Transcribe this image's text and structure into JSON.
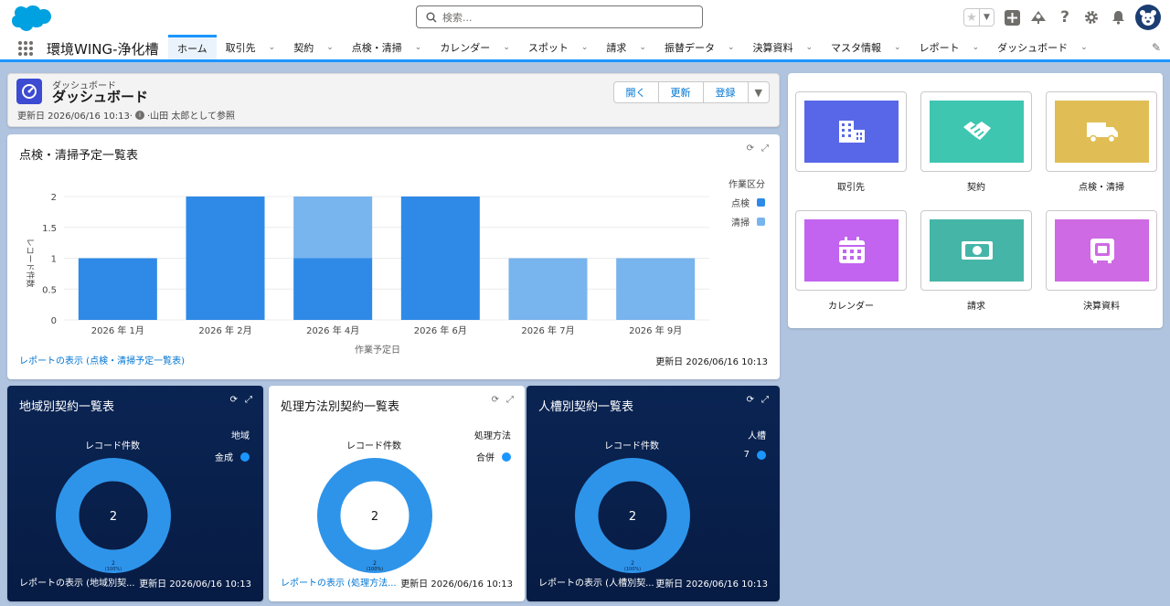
{
  "header": {
    "search_placeholder": "検索..."
  },
  "nav": {
    "app_name": "環境WING-浄化槽",
    "tabs": [
      {
        "label": "ホーム",
        "active": true,
        "has_menu": false
      },
      {
        "label": "取引先",
        "has_menu": true
      },
      {
        "label": "契約",
        "has_menu": true
      },
      {
        "label": "点検・清掃",
        "has_menu": true
      },
      {
        "label": "カレンダー",
        "has_menu": true
      },
      {
        "label": "スポット",
        "has_menu": true
      },
      {
        "label": "請求",
        "has_menu": true
      },
      {
        "label": "振替データ",
        "has_menu": true
      },
      {
        "label": "決算資料",
        "has_menu": true
      },
      {
        "label": "マスタ情報",
        "has_menu": true
      },
      {
        "label": "レポート",
        "has_menu": true
      },
      {
        "label": "ダッシュボード",
        "has_menu": true
      }
    ]
  },
  "dashboard": {
    "subtitle": "ダッシュボード",
    "title": "ダッシュボード",
    "updated": "更新日 2026/06/16 10:13·",
    "viewing_as": "·山田 太郎として参照",
    "buttons": {
      "open": "開く",
      "refresh": "更新",
      "subscribe": "登録"
    }
  },
  "chart_main": {
    "title": "点検・清掃予定一覧表",
    "view_report": "レポートの表示 (点検・清掃予定一覧表)",
    "updated": "更新日 2026/06/16 10:13"
  },
  "chart_data": [
    {
      "type": "bar",
      "stacked": true,
      "title": "点検・清掃予定一覧表",
      "xlabel": "作業予定日",
      "ylabel": "レコード件数",
      "categories": [
        "2026 年 1月",
        "2026 年 2月",
        "2026 年 4月",
        "2026 年 6月",
        "2026 年 7月",
        "2026 年 9月"
      ],
      "yticks": [
        "0",
        "0.5",
        "1",
        "1.5",
        "2"
      ],
      "ylim": [
        0,
        2
      ],
      "legend_title": "作業区分",
      "legend_position": "top-right",
      "series": [
        {
          "name": "点検",
          "color": "#2e8ae6",
          "values": [
            1,
            2,
            1,
            2,
            0,
            0
          ]
        },
        {
          "name": "清掃",
          "color": "#78b4ee",
          "values": [
            0,
            0,
            1,
            0,
            1,
            1
          ]
        }
      ]
    },
    {
      "type": "pie",
      "donut": true,
      "title": "地域別契約一覧表",
      "measure": "レコード件数",
      "legend_title": "地域",
      "slices": [
        {
          "name": "金成",
          "value": 2,
          "label": "2",
          "pct": "(100%)"
        }
      ],
      "total": "2"
    },
    {
      "type": "pie",
      "donut": true,
      "title": "処理方法別契約一覧表",
      "measure": "レコード件数",
      "legend_title": "処理方法",
      "slices": [
        {
          "name": "合併",
          "value": 2,
          "label": "2",
          "pct": "(100%)"
        }
      ],
      "total": "2"
    },
    {
      "type": "pie",
      "donut": true,
      "title": "人槽別契約一覧表",
      "measure": "レコード件数",
      "legend_title": "人槽",
      "slices": [
        {
          "name": "7",
          "value": 2,
          "label": "2",
          "pct": "(100%)"
        }
      ],
      "total": "2"
    }
  ],
  "donuts": [
    {
      "view_report": "レポートの表示 (地域別契...",
      "updated": "更新日 2026/06/16 10:13"
    },
    {
      "view_report": "レポートの表示 (処理方法...",
      "updated": "更新日 2026/06/16 10:13"
    },
    {
      "view_report": "レポートの表示 (人槽別契...",
      "updated": "更新日 2026/06/16 10:13"
    }
  ],
  "tiles": [
    {
      "label": "取引先",
      "color": "#5867e8",
      "icon": "building-icon"
    },
    {
      "label": "契約",
      "color": "#3ec6b1",
      "icon": "handshake-icon"
    },
    {
      "label": "点検・清掃",
      "color": "#e0be55",
      "icon": "truck-icon"
    },
    {
      "label": "カレンダー",
      "color": "#c264f0",
      "icon": "calendar-icon"
    },
    {
      "label": "請求",
      "color": "#45b5a8",
      "icon": "money-icon"
    },
    {
      "label": "決算資料",
      "color": "#ce6ae3",
      "icon": "safe-icon"
    }
  ]
}
